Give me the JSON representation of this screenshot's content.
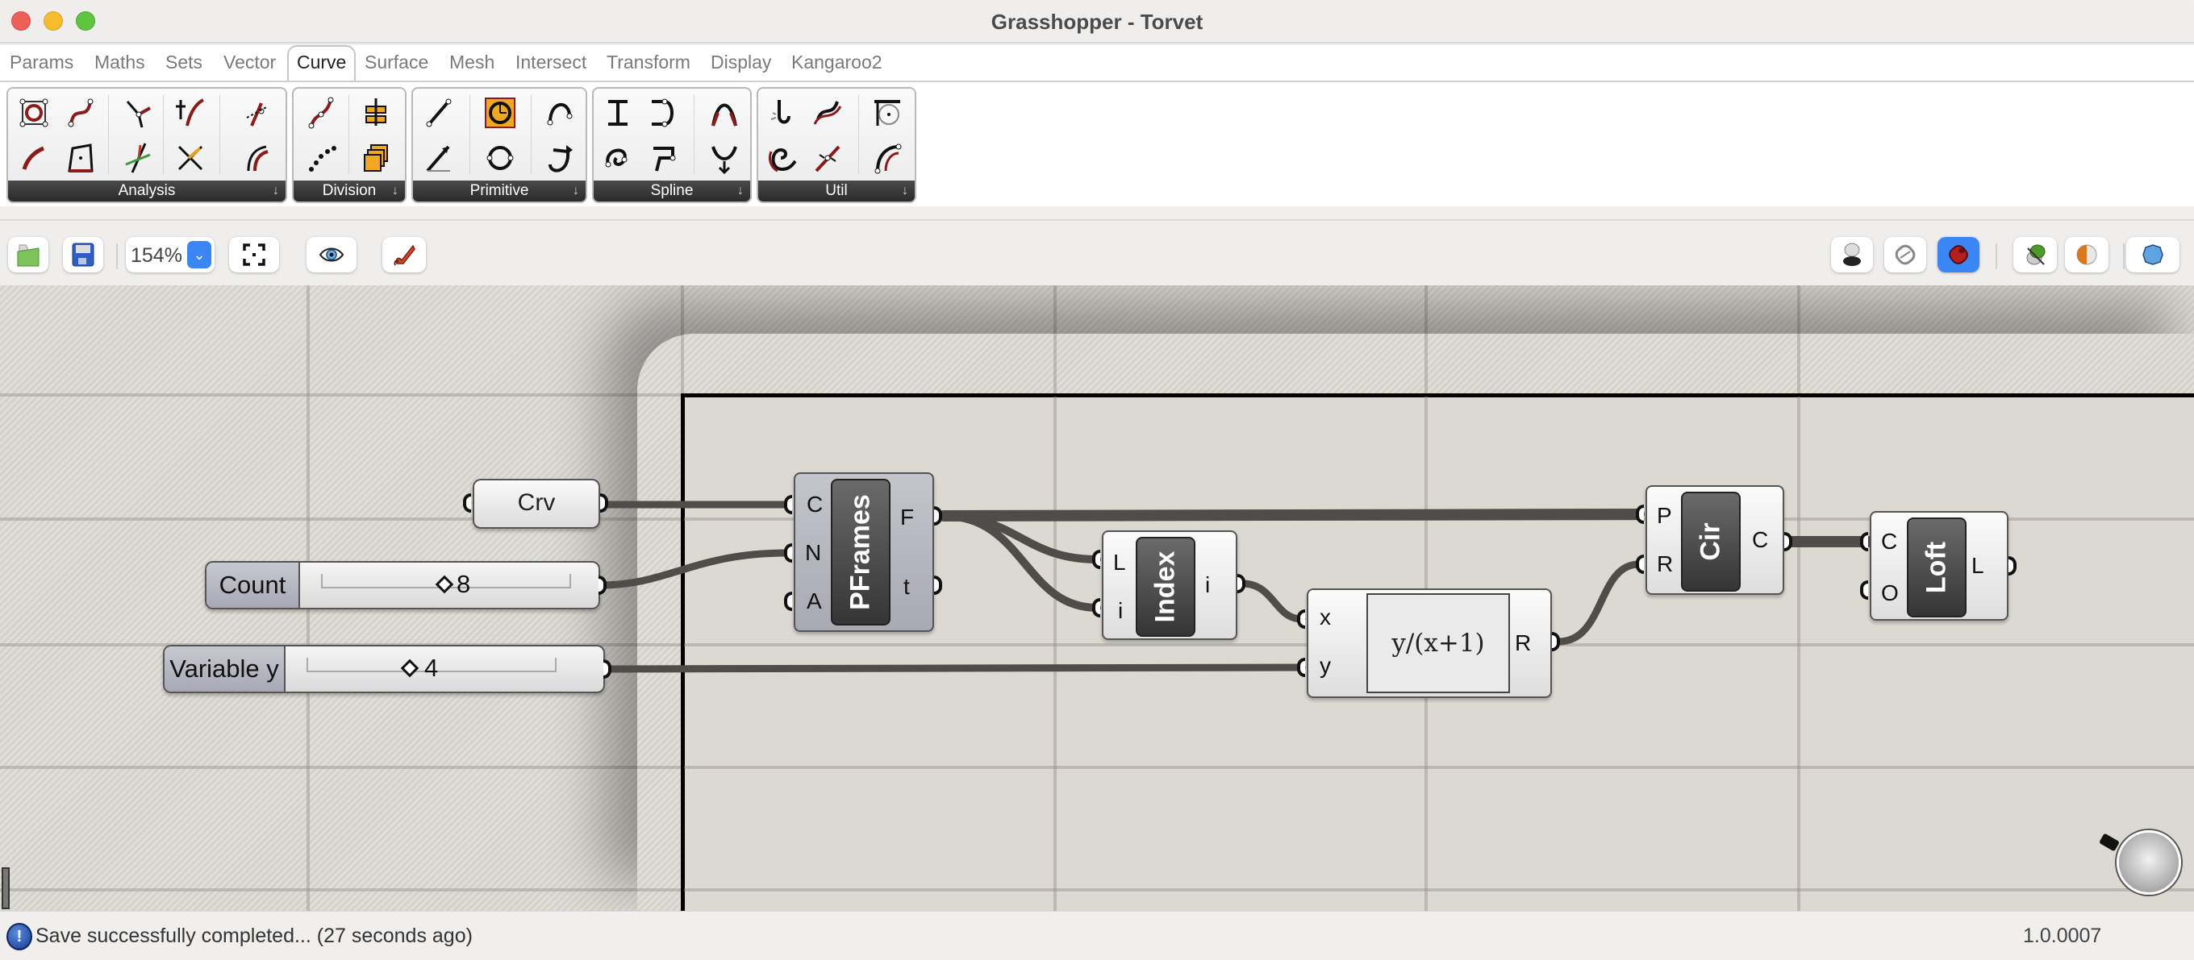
{
  "window": {
    "title": "Grasshopper - Torvet"
  },
  "tabs": [
    {
      "label": "Params",
      "active": false
    },
    {
      "label": "Maths",
      "active": false
    },
    {
      "label": "Sets",
      "active": false
    },
    {
      "label": "Vector",
      "active": false
    },
    {
      "label": "Curve",
      "active": true
    },
    {
      "label": "Surface",
      "active": false
    },
    {
      "label": "Mesh",
      "active": false
    },
    {
      "label": "Intersect",
      "active": false
    },
    {
      "label": "Transform",
      "active": false
    },
    {
      "label": "Display",
      "active": false
    },
    {
      "label": "Kangaroo2",
      "active": false
    }
  ],
  "ribbon": {
    "panels": [
      {
        "label": "Analysis",
        "expand_icon": "↓"
      },
      {
        "label": "Division",
        "expand_icon": "↓"
      },
      {
        "label": "Primitive",
        "expand_icon": "↓"
      },
      {
        "label": "Spline",
        "expand_icon": "↓"
      },
      {
        "label": "Util",
        "expand_icon": "↓"
      }
    ]
  },
  "toolbar": {
    "open_icon": "folder-open-icon",
    "save_icon": "floppy-save-icon",
    "zoom_level": "154%",
    "zoom_dropdown_icon": "⌄",
    "zoom_extents_icon": "zoom-extents-icon",
    "preview_icon": "eye-icon",
    "sketch_icon": "pen-sketch-icon",
    "right_buttons": [
      {
        "name": "no-preview-button",
        "icon": "no-preview-icon",
        "active": false
      },
      {
        "name": "wireframe-preview-button",
        "icon": "wireframe-icon",
        "active": false
      },
      {
        "name": "shaded-preview-button",
        "icon": "shaded-icon",
        "active": true
      },
      {
        "name": "selected-only-preview-button",
        "icon": "selected-preview-icon",
        "active": false
      },
      {
        "name": "preview-material-button",
        "icon": "material-icon",
        "active": false
      },
      {
        "name": "preview-mesh-quality-button",
        "icon": "mesh-quality-icon",
        "active": false
      }
    ]
  },
  "canvas": {
    "params": [
      {
        "name": "Crv"
      }
    ],
    "sliders": [
      {
        "label": "Count",
        "value": "8",
        "fraction": 0.48
      },
      {
        "label": "Variable y",
        "value": "4",
        "fraction": 0.4
      }
    ],
    "components": {
      "pframes": {
        "name": "PFrames",
        "inputs": [
          "C",
          "N",
          "A"
        ],
        "outputs": [
          "F",
          "t"
        ]
      },
      "index": {
        "name": "Index",
        "inputs": [
          "L",
          "i"
        ],
        "outputs": [
          "i"
        ]
      },
      "expression": {
        "expression": "y/(x+1)",
        "inputs": [
          "x",
          "y"
        ],
        "outputs": [
          "R"
        ]
      },
      "circle": {
        "name": "Cir",
        "inputs": [
          "P",
          "R"
        ],
        "outputs": [
          "C"
        ]
      },
      "loft": {
        "name": "Loft",
        "inputs": [
          "C",
          "O"
        ],
        "outputs": [
          "L"
        ]
      }
    }
  },
  "status": {
    "message": "Save successfully completed... (27 seconds ago)",
    "icon": "!",
    "version": "1.0.0007"
  }
}
